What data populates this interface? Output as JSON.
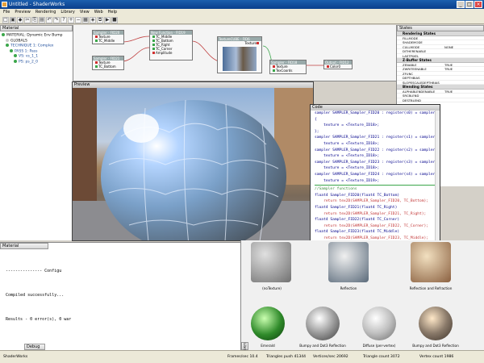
{
  "window": {
    "title": "Untitled - ShaderWorks"
  },
  "menu": [
    "File",
    "Preview",
    "Rendering",
    "Library",
    "View",
    "Web",
    "Help"
  ],
  "toolbar_icons": [
    "new-icon",
    "open-icon",
    "save-icon",
    "cut-icon",
    "copy-icon",
    "paste-icon",
    "undo-icon",
    "redo-icon",
    "help-icon",
    "zoom-in-icon",
    "zoom-out-icon",
    "grid-icon",
    "node-icon",
    "link-icon",
    "run-icon",
    "stop-icon"
  ],
  "material_tree": [
    {
      "label": "MATERIAL: Dynamic Env Bump",
      "color": "#3aa64a",
      "depth": 0
    },
    {
      "label": "GLOBALS",
      "color": "#cccccc",
      "depth": 1
    },
    {
      "label": "TECHNIQUE 1: Complex",
      "color": "#3aa64a",
      "depth": 1
    },
    {
      "label": "PASS 1: Pass",
      "color": "#3aa64a",
      "depth": 2
    },
    {
      "label": "VS: vs_1_1",
      "color": "#3aa64a",
      "depth": 3
    },
    {
      "label": "PS: ps_2_0",
      "color": "#3aa64a",
      "depth": 3
    }
  ],
  "panels": {
    "material": "Material",
    "preview": "Preview",
    "code": "Code",
    "states": "States",
    "debug": "Debug",
    "library": "Library"
  },
  "graph_nodes": [
    {
      "title": "Sampler - FID20",
      "rows": [
        "Texture",
        "TC_Middle"
      ]
    },
    {
      "title": "New Function - FID19",
      "rows": [
        "TC_Middle",
        "TC_Bottom",
        "TC_Right",
        "TC_Corner",
        "Amplitude"
      ]
    },
    {
      "title": "Sampler - FID21",
      "rows": [
        "Texture",
        "TC_Bottom"
      ]
    },
    {
      "title": "TextureCUBE - FID6",
      "rows": [
        "Texture"
      ]
    },
    {
      "title": "Sampler - FID18",
      "rows": [
        "Texture",
        "TexCoords"
      ]
    },
    {
      "title": "Output - FID12",
      "rows": [
        "Color0"
      ]
    }
  ],
  "states": {
    "rendering": [
      "FILLMODE",
      "SHADEMODE",
      "CULLMODE",
      "DITHERENABLE",
      "LASTPIXEL"
    ],
    "rendering_values": [
      "",
      "",
      "NONE",
      "",
      ""
    ],
    "zbuffer": [
      "ZENABLE",
      "ZWRITEENABLE",
      "ZFUNC",
      "DEPTHBIAS",
      "SLOPESCALEDEPTHBIAS"
    ],
    "zbuffer_values": [
      "TRUE",
      "TRUE",
      "",
      "",
      ""
    ],
    "blending": [
      "ALPHABLENDENABLE",
      "SRCBLEND",
      "DESTBLEND"
    ],
    "blending_values": [
      "TRUE",
      "",
      ""
    ],
    "section_titles": [
      "Rendering States",
      "Z-Buffer States",
      "Blending States"
    ]
  },
  "code_lines": [
    "sampler SAMPLER_Sampler_FID20 : register(s0) = sampler_st",
    "{",
    "    texture = <Texture_ID18>;",
    "};",
    "sampler SAMPLER_Sampler_FID21 : register(s1) = sampler_st",
    "    texture = <Texture_ID18>;",
    "sampler SAMPLER_Sampler_FID22 : register(s2) = sampler_st",
    "    texture = <Texture_ID18>;",
    "sampler SAMPLER_Sampler_FID23 : register(s3) = sampler_st",
    "    texture = <Texture_ID18>;",
    "sampler SAMPLER_Sampler_FID24 : register(s4) = sampler_st",
    "    texture = <Texture_ID19>;",
    "",
    "//Sampler functions",
    "",
    "float4 Sampler_FID20(float4 TC_Bottom)",
    "    return tex2D(SAMPLER_Sampler_FID20, TC_Bottom);",
    "float4 Sampler_FID21(float4 TC_Right)",
    "    return tex2D(SAMPLER_Sampler_FID21, TC_Right);",
    "float4 Sampler_FID22(float4 TC_Corner)",
    "    return tex2D(SAMPLER_Sampler_FID22, TC_Corner);",
    "float4 Sampler_FID23(float4 TC_Middle)",
    "    return tex2D(SAMPLER_Sampler_FID23, TC_Middle);"
  ],
  "code_tabs": [
    "HLSL code",
    "HLSL globals",
    "ASM output"
  ],
  "output": {
    "header": "--------------- Configu",
    "line1": "Compiled successfully...",
    "line2": "Results - 0 error(s), 0 war"
  },
  "library_items": [
    {
      "label": "(noTexture)"
    },
    {
      "label": "Reflection"
    },
    {
      "label": "Reflection and Refraction"
    },
    {
      "label": "Emerald"
    },
    {
      "label": "Bumpy and Dot3 Reflection"
    },
    {
      "label": "Diffuse (per-vertex)"
    },
    {
      "label": "Bumpy and Dot3 Reflection"
    }
  ],
  "status": {
    "app": "ShaderWorks",
    "fps": "Frames/sec  10.4",
    "triangles": "Triangles push  41344",
    "vertices": "Vertices/sec  20692",
    "tri_count": "Triangle count  3072",
    "vert_count": "Vertex count  1986"
  }
}
